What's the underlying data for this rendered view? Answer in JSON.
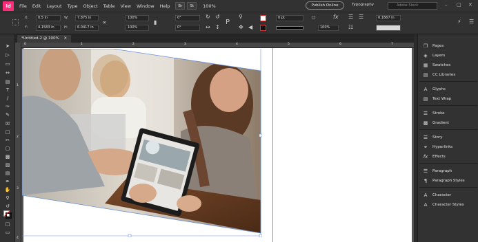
{
  "app": {
    "logo": "Id"
  },
  "menu": [
    "File",
    "Edit",
    "Layout",
    "Type",
    "Object",
    "Table",
    "View",
    "Window",
    "Help"
  ],
  "menubar": {
    "br_label": "Br",
    "st_label": "St",
    "zoom": "100%",
    "publish": "Publish Online",
    "workspace": "Typography",
    "search_placeholder": "Adobe Stock"
  },
  "control": {
    "x_label": "X:",
    "x_value": "0.5 in",
    "y_label": "Y:",
    "y_value": "4.1583 in",
    "w_label": "W:",
    "w_value": "7.875 in",
    "h_label": "H:",
    "h_value": "6.0417 in",
    "scale_x": "100%",
    "scale_y": "100%",
    "rotate": "0°",
    "shear": "0°",
    "stroke_weight": "0 pt",
    "opacity": "100%",
    "offset": "0.1667 in"
  },
  "document": {
    "tab_title": "*Untitled-2 @ 100%",
    "ruler_h": [
      "0",
      "1",
      "2",
      "3",
      "4",
      "5",
      "6",
      "7"
    ],
    "ruler_v": [
      "1",
      "2",
      "3",
      "4"
    ]
  },
  "panels": [
    {
      "icon": "pages-icon",
      "label": "Pages"
    },
    {
      "icon": "layers-icon",
      "label": "Layers"
    },
    {
      "icon": "swatches-icon",
      "label": "Swatches"
    },
    {
      "icon": "cc-libraries-icon",
      "label": "CC Libraries"
    },
    {
      "icon": "glyphs-icon",
      "label": "Glyphs"
    },
    {
      "icon": "text-wrap-icon",
      "label": "Text Wrap"
    },
    {
      "icon": "stroke-icon",
      "label": "Stroke"
    },
    {
      "icon": "gradient-icon",
      "label": "Gradient"
    },
    {
      "icon": "story-icon",
      "label": "Story"
    },
    {
      "icon": "hyperlinks-icon",
      "label": "Hyperlinks"
    },
    {
      "icon": "effects-icon",
      "label": "Effects"
    },
    {
      "icon": "paragraph-icon",
      "label": "Paragraph"
    },
    {
      "icon": "paragraph-styles-icon",
      "label": "Paragraph Styles"
    },
    {
      "icon": "character-icon",
      "label": "Character"
    },
    {
      "icon": "character-styles-icon",
      "label": "Character Styles"
    }
  ],
  "colors": {
    "accent": "#ff2d78",
    "guide": "#c86ec8",
    "frame": "#6a8fd8"
  }
}
